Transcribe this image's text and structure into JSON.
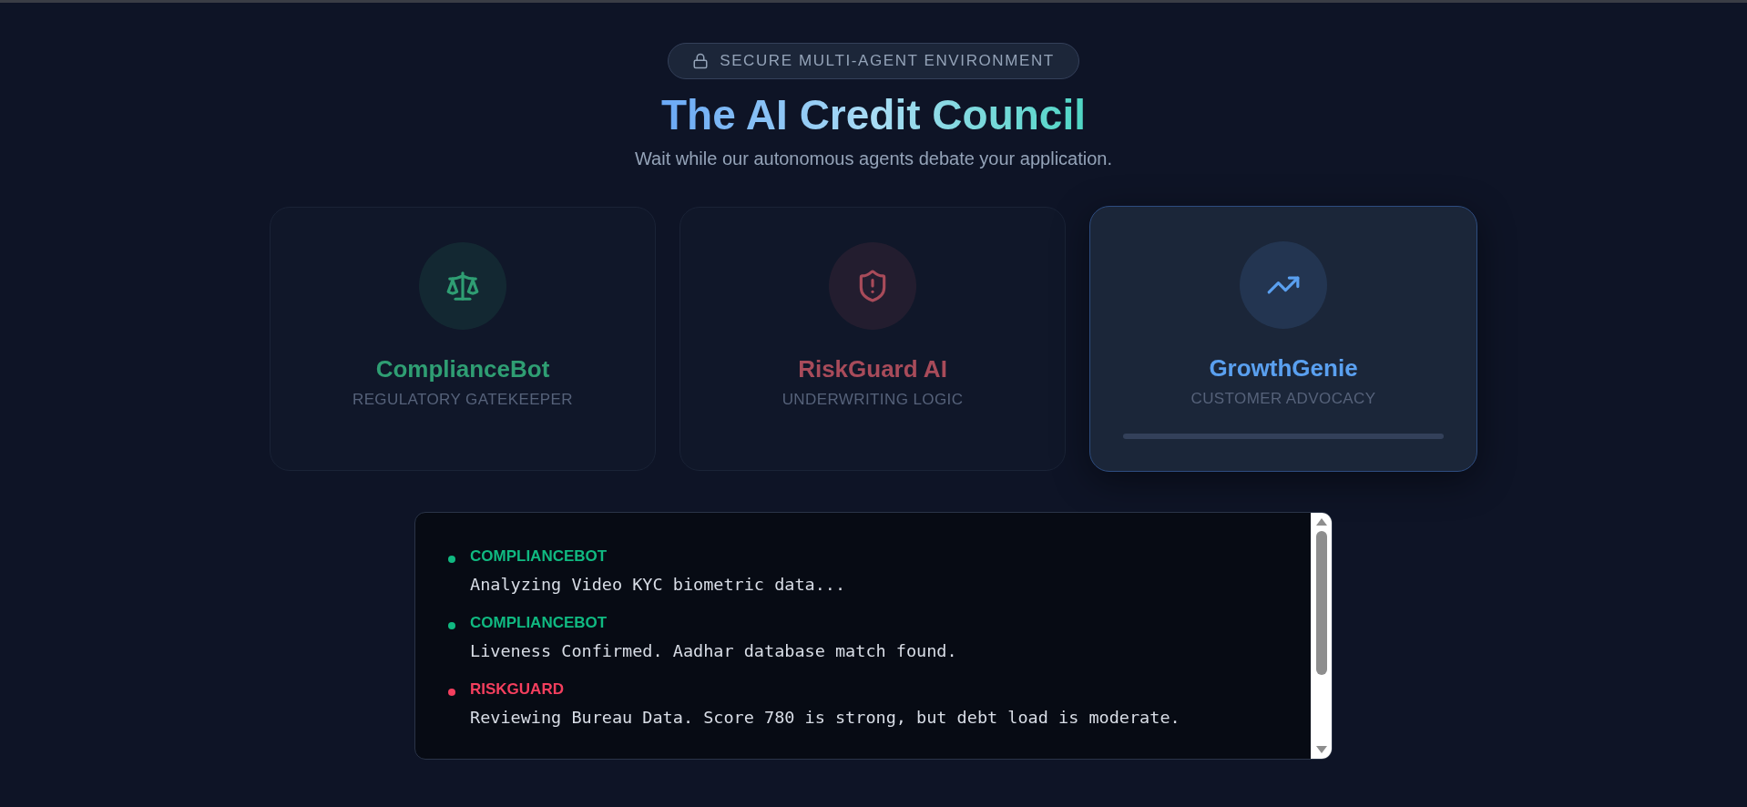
{
  "badge": {
    "label": "SECURE MULTI-AGENT ENVIRONMENT"
  },
  "title": "The AI Credit Council",
  "subtitle": "Wait while our autonomous agents debate your application.",
  "agents": [
    {
      "name": "ComplianceBot",
      "role": "REGULATORY GATEKEEPER",
      "kind": "scale",
      "color": "#2f9e73",
      "active": false
    },
    {
      "name": "RiskGuard AI",
      "role": "UNDERWRITING LOGIC",
      "kind": "shield",
      "color": "#a84b5a",
      "active": false
    },
    {
      "name": "GrowthGenie",
      "role": "CUSTOMER ADVOCACY",
      "kind": "trend",
      "color": "#5aa0f0",
      "active": true,
      "progress": {
        "level": 0
      }
    }
  ],
  "log": [
    {
      "agent": "COMPLIANCEBOT",
      "message": "Analyzing Video KYC biometric data...",
      "color": "#10b981"
    },
    {
      "agent": "COMPLIANCEBOT",
      "message": "Liveness Confirmed. Aadhar database match found.",
      "color": "#10b981"
    },
    {
      "agent": "RISKGUARD",
      "message": "Reviewing Bureau Data. Score 780 is strong, but debt load is moderate.",
      "color": "#f43f5e"
    }
  ]
}
